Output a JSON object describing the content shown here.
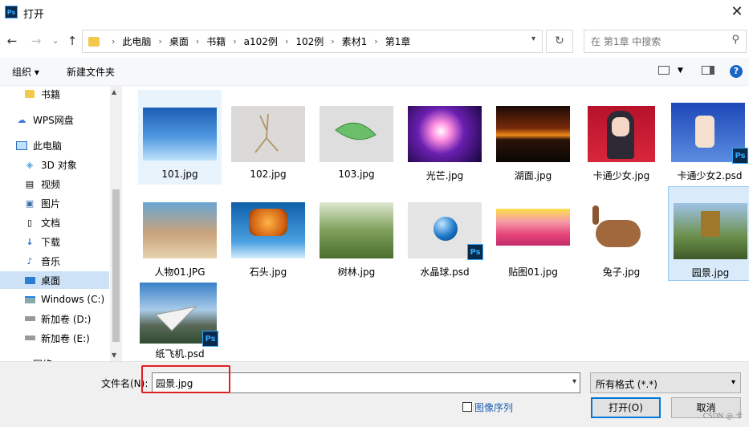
{
  "window": {
    "title": "打开",
    "close": "✕",
    "app_icon": "Ps"
  },
  "nav": {
    "back": "←",
    "forward": "→",
    "recent": "⌄",
    "up": "↑",
    "breadcrumbs": [
      "此电脑",
      "桌面",
      "书籍",
      "a102例",
      "102例",
      "素材1",
      "第1章"
    ],
    "sep": "›",
    "refresh": "↻",
    "search_placeholder": "在 第1章 中搜索"
  },
  "toolbar": {
    "organize": "组织 ▾",
    "new_folder": "新建文件夹",
    "help": "?"
  },
  "sidebar": {
    "items": [
      {
        "label": "书籍",
        "icon": "folder-icon"
      },
      {
        "label": "WPS网盘",
        "icon": "cloud-icon"
      },
      {
        "label": "此电脑",
        "icon": "computer-icon"
      },
      {
        "label": "3D 对象",
        "icon": "cube-icon"
      },
      {
        "label": "视频",
        "icon": "video-icon"
      },
      {
        "label": "图片",
        "icon": "picture-icon"
      },
      {
        "label": "文档",
        "icon": "document-icon"
      },
      {
        "label": "下载",
        "icon": "download-icon"
      },
      {
        "label": "音乐",
        "icon": "music-icon"
      },
      {
        "label": "桌面",
        "icon": "desktop-icon"
      },
      {
        "label": "Windows (C:)",
        "icon": "drive-icon"
      },
      {
        "label": "新加卷 (D:)",
        "icon": "drive-icon"
      },
      {
        "label": "新加卷 (E:)",
        "icon": "drive-icon"
      },
      {
        "label": "网络",
        "icon": "network-icon"
      }
    ]
  },
  "files": [
    {
      "name": "101.jpg"
    },
    {
      "name": "102.jpg"
    },
    {
      "name": "103.jpg"
    },
    {
      "name": "光芒.jpg"
    },
    {
      "name": "湖面.jpg"
    },
    {
      "name": "卡通少女.jpg"
    },
    {
      "name": "卡通少女2.psd"
    },
    {
      "name": "人物01.JPG"
    },
    {
      "name": "石头.jpg"
    },
    {
      "name": "树林.jpg"
    },
    {
      "name": "水晶球.psd"
    },
    {
      "name": "贴图01.jpg"
    },
    {
      "name": "兔子.jpg"
    },
    {
      "name": "园景.jpg"
    },
    {
      "name": "纸飞机.psd"
    }
  ],
  "bottom": {
    "filename_label": "文件名(N):",
    "filename_value": "园景.jpg",
    "filter": "所有格式 (*.*)",
    "image_sequence": "图像序列",
    "open": "打开(O)",
    "cancel": "取消",
    "watermark": "CSDN @.卡"
  }
}
